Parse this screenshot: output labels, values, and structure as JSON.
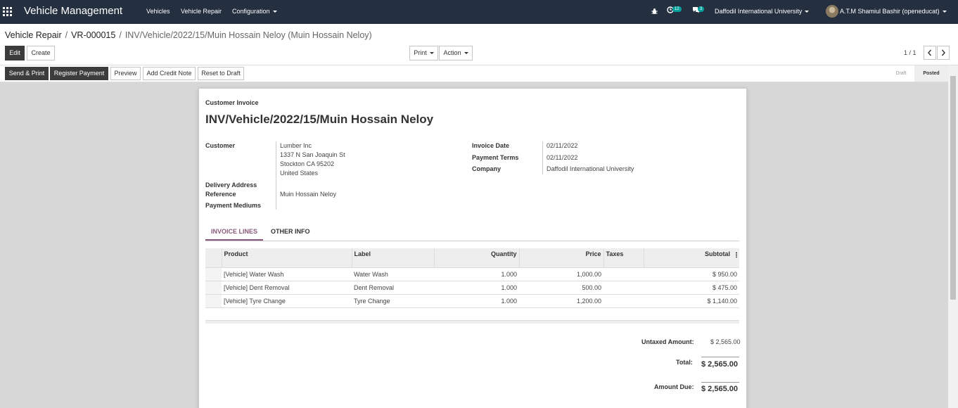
{
  "navbar": {
    "app_title": "Vehicle Management",
    "menu": [
      "Vehicles",
      "Vehicle Repair",
      "Configuration"
    ],
    "activity_count": "12",
    "message_count": "3",
    "company": "Daffodil International University",
    "user": "A.T.M Shamiul Bashir (openeducat)"
  },
  "breadcrumb": {
    "items": [
      "Vehicle Repair",
      "VR-000015"
    ],
    "current": "INV/Vehicle/2022/15/Muin Hossain Neloy (Muin Hossain Neloy)"
  },
  "control": {
    "edit": "Edit",
    "create": "Create",
    "print": "Print",
    "action": "Action",
    "pager": "1 / 1"
  },
  "status_buttons": [
    "Send & Print",
    "Register Payment",
    "Preview",
    "Add Credit Note",
    "Reset to Draft"
  ],
  "stages": {
    "draft": "Draft",
    "posted": "Posted",
    "current": "Posted"
  },
  "invoice": {
    "type_label": "Customer Invoice",
    "name": "INV/Vehicle/2022/15/Muin Hossain Neloy",
    "customer_label": "Customer",
    "customer_lines": [
      "Lumber Inc",
      "1337 N San Joaquin St",
      "Stockton CA 95202",
      "United States"
    ],
    "delivery_address_label": "Delivery Address",
    "reference_label": "Reference",
    "reference": "Muin Hossain Neloy",
    "payment_mediums_label": "Payment Mediums",
    "invoice_date_label": "Invoice Date",
    "invoice_date": "02/11/2022",
    "payment_terms_label": "Payment Terms",
    "payment_terms": "02/11/2022",
    "company_label": "Company",
    "company": "Daffodil International University"
  },
  "tabs": [
    "INVOICE LINES",
    "OTHER INFO"
  ],
  "lines": {
    "headers": [
      "Product",
      "Label",
      "Quantity",
      "Price",
      "Taxes",
      "Subtotal"
    ],
    "rows": [
      {
        "product": "[Vehicle] Water Wash",
        "label": "Water Wash",
        "quantity": "1.000",
        "price": "1,000.00",
        "taxes": "",
        "subtotal": "$ 950.00"
      },
      {
        "product": "[Vehicle] Dent Removal",
        "label": "Dent Removal",
        "quantity": "1.000",
        "price": "500.00",
        "taxes": "",
        "subtotal": "$ 475.00"
      },
      {
        "product": "[Vehicle] Tyre Change",
        "label": "Tyre Change",
        "quantity": "1.000",
        "price": "1,200.00",
        "taxes": "",
        "subtotal": "$ 1,140.00"
      }
    ]
  },
  "totals": {
    "untaxed_label": "Untaxed Amount:",
    "untaxed": "$ 2,565.00",
    "total_label": "Total:",
    "total": "$ 2,565.00",
    "amount_due_label": "Amount Due:",
    "amount_due": "$ 2,565.00"
  },
  "colors": {
    "navbar": "#243040",
    "accent": "#875a7b",
    "badge": "#00a09d"
  }
}
